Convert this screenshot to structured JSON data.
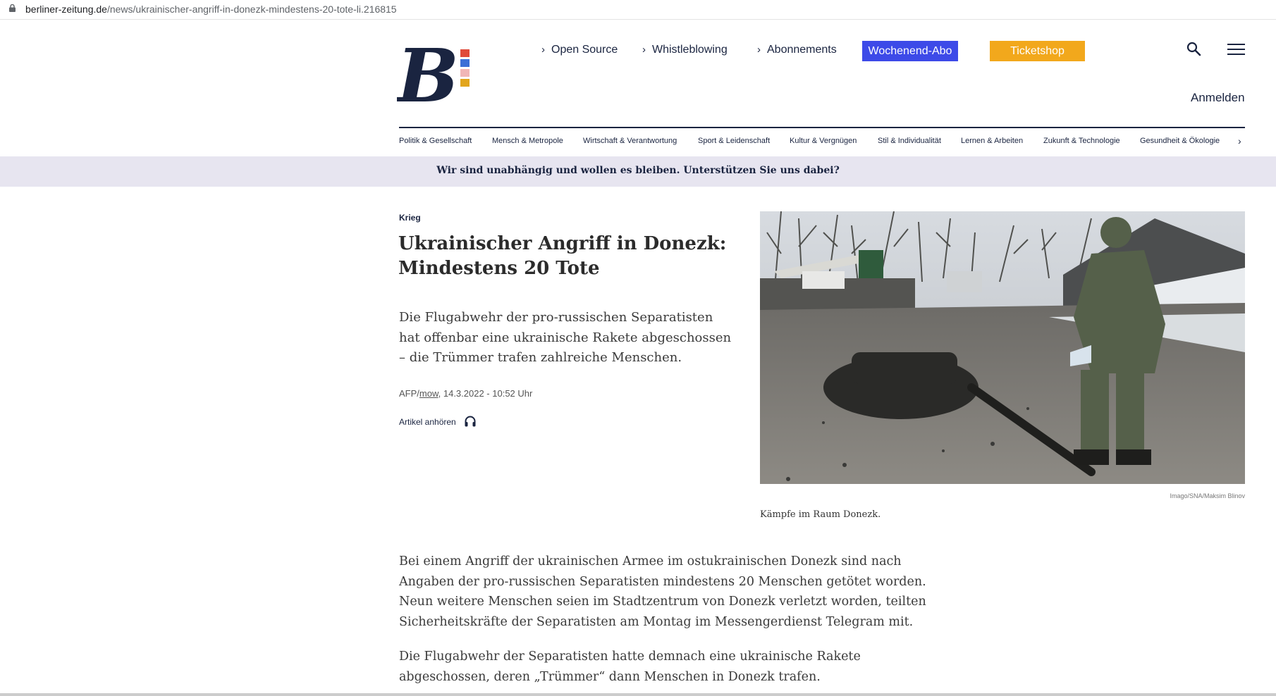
{
  "browser": {
    "url_domain": "berliner-zeitung.de",
    "url_path": "/news/ukrainischer-angriff-in-donezk-mindestens-20-tote-li.216815"
  },
  "header": {
    "nav": [
      "Open Source",
      "Whistleblowing",
      "Abonnements"
    ],
    "abo_button": "Wochenend-Abo",
    "ticket_button": "Ticketshop",
    "login": "Anmelden"
  },
  "categories": [
    "Politik & Gesellschaft",
    "Mensch & Metropole",
    "Wirtschaft & Verantwortung",
    "Sport & Leidenschaft",
    "Kultur & Vergnügen",
    "Stil & Individualität",
    "Lernen & Arbeiten",
    "Zukunft & Technologie",
    "Gesundheit & Ökologie"
  ],
  "banner": "Wir sind unabhängig und wollen es bleiben. Unterstützen Sie uns dabei?",
  "article": {
    "kicker": "Krieg",
    "headline": "Ukrainischer Angriff in Donezk: Mindestens 20 Tote",
    "lead": "Die Flugabwehr der pro-russischen Separatisten hat offenbar eine ukrainische Rakete abgeschossen – die Trümmer trafen zahlreiche Menschen.",
    "byline_agency": "AFP/",
    "byline_author": "mow",
    "byline_date": ", 14.3.2022 - 10:52 Uhr",
    "listen": "Artikel anhören",
    "image_credit": "Imago/SNA/Maksim Blinov",
    "image_caption": "Kämpfe im Raum Donezk.",
    "paragraphs": [
      "Bei einem Angriff der ukrainischen Armee im ostukrainischen Donezk sind nach Angaben der pro-russischen Separatisten mindestens 20 Menschen getötet worden. Neun weitere Menschen seien im Stadtzentrum von Donezk verletzt worden, teilten Sicherheitskräfte der Separatisten am Montag im Messengerdienst Telegram mit.",
      "Die Flugabwehr der Separatisten hatte demnach eine ukrainische Rakete abgeschossen, deren „Trümmer“ dann Menschen in Donezk trafen."
    ]
  },
  "colors": {
    "navy": "#1a2440",
    "abo_blue": "#3d4ae8",
    "ticket_orange": "#f2a81c",
    "banner_bg": "#e7e5f0",
    "logo_squares": [
      "#e04a3a",
      "#3b6fd6",
      "#f1b6b6",
      "#e2a51c"
    ]
  },
  "icons": [
    "lock-icon",
    "chevron-right-icon",
    "search-icon",
    "hamburger-menu-icon",
    "headphones-icon"
  ]
}
